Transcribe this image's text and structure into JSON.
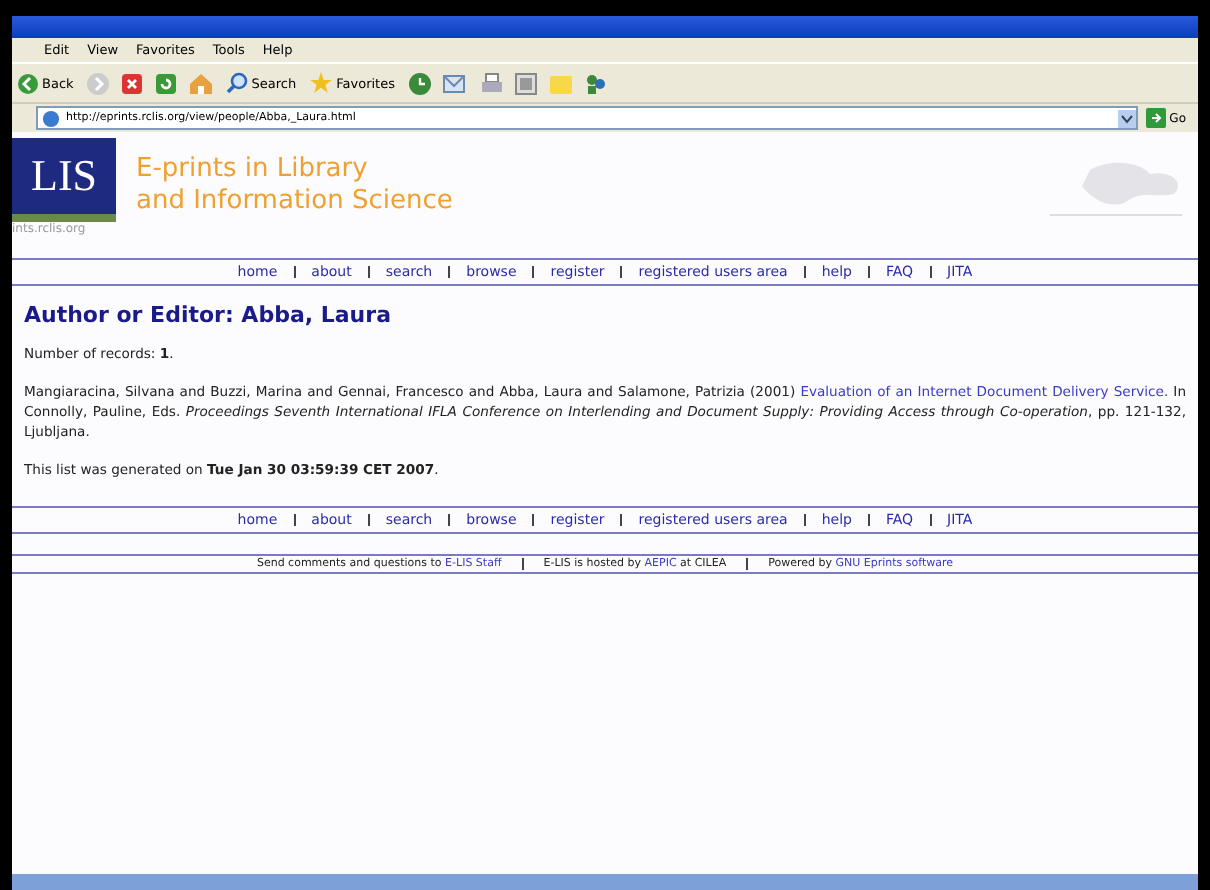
{
  "browser": {
    "menu": [
      "Edit",
      "View",
      "Favorites",
      "Tools",
      "Help"
    ],
    "toolbar": [
      "Back",
      "Search",
      "Favorites"
    ],
    "address": "http://eprints.rclis.org/view/people/Abba,_Laura.html",
    "go": "Go"
  },
  "header": {
    "logo": "LIS",
    "title_lines": [
      "E-prints in Library",
      "and Information Science"
    ],
    "site": "ints.rclis.org"
  },
  "nav": [
    "home",
    "about",
    "search",
    "browse",
    "register",
    "registered users area",
    "help",
    "FAQ",
    "JITA"
  ],
  "heading": "Author or Editor: Abba, Laura",
  "records": "Number of records: **1**.",
  "citation": {
    "authors": "Mangiaracina, Silvana and Buzzi, Marina and Gennai, Francesco and Abba, Laura and Salamone, Patrizia (2001) ",
    "title_link": "Evaluation of an Internet Document Delivery Service.",
    "source": " In Connolly, Pauline, Eds. *Proceedings Seventh International IFLA Conference on Interlending and Document Supply: Providing Access through Co-operation*, pp. 121-132, Ljubljana."
  },
  "generated": "This list was generated on **Tue Jan 30 03:59:39 CET 2007**.",
  "nav_bottom": [
    "home",
    "about",
    "search",
    "browse",
    "register",
    "registered users area",
    "help",
    "FAQ",
    "JITA"
  ],
  "footer": [
    {
      "text": "Send comments and questions to ",
      "link": "E-LIS Staff"
    },
    {
      "text": "E-LIS is hosted by ",
      "link": "AEPIC",
      "after": " at CILEA"
    },
    {
      "text": "Powered by ",
      "link": "GNU Eprints software"
    }
  ]
}
